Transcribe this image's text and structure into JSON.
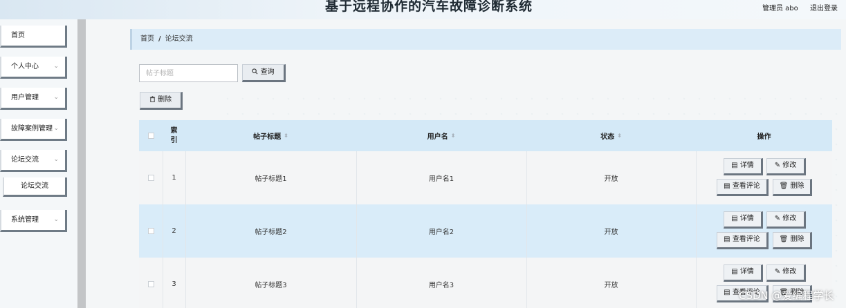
{
  "header": {
    "title": "基于远程协作的汽车故障诊断系统",
    "admin_label": "管理员 abo",
    "logout": "退出登录"
  },
  "sidebar": {
    "items": [
      {
        "label": "首页"
      },
      {
        "label": "个人中心",
        "chevron": "⌄"
      },
      {
        "label": "用户管理",
        "chevron": "⌄"
      },
      {
        "label": "故障案例管理",
        "chevron": "⌄"
      },
      {
        "label": "论坛交流",
        "chevron": "⌄",
        "sub": "论坛交流"
      },
      {
        "label": "系统管理",
        "chevron": "⌄"
      }
    ]
  },
  "breadcrumb": {
    "home": "首页",
    "sep": "/",
    "current": "论坛交流"
  },
  "search": {
    "placeholder": "帖子标题",
    "button": "查询",
    "button_icon": "search-icon"
  },
  "toolbar": {
    "delete": "删除",
    "delete_icon": "trash-icon"
  },
  "table": {
    "columns": [
      "索引",
      "帖子标题",
      "用户名",
      "状态",
      "操作"
    ],
    "index_head": [
      "索",
      "引"
    ],
    "rows": [
      {
        "index": "1",
        "title": "帖子标题1",
        "user": "用户名1",
        "status": "开放"
      },
      {
        "index": "2",
        "title": "帖子标题2",
        "user": "用户名2",
        "status": "开放"
      },
      {
        "index": "3",
        "title": "帖子标题3",
        "user": "用户名3",
        "status": "开放"
      }
    ],
    "actions": {
      "detail": "详情",
      "edit": "修改",
      "comments": "查看评论",
      "delete": "删除"
    }
  },
  "watermark": "CSDN @爱编程学长"
}
